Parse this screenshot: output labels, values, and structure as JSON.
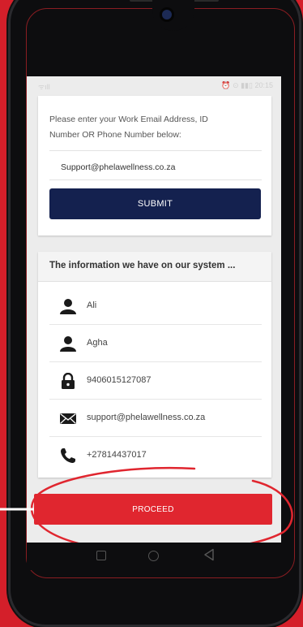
{
  "status_bar": {
    "signal": "ᯤıll",
    "right_icons": "⏰ ⊙ ▮▮▯ 20:15"
  },
  "email_card": {
    "prompt": "Please enter your Work Email Address, ID Number OR Phone Number below:",
    "input_value": "Support@phelawellness.co.za",
    "submit_label": "SUBMIT"
  },
  "info_card": {
    "title": "The information we have on our system ...",
    "rows": [
      {
        "icon": "person-icon",
        "value": "Ali"
      },
      {
        "icon": "person-icon",
        "value": "Agha"
      },
      {
        "icon": "lock-icon",
        "value": "9406015127087"
      },
      {
        "icon": "envelope-icon",
        "value": "support@phelawellness.co.za"
      },
      {
        "icon": "phone-icon",
        "value": "+27814437017"
      }
    ]
  },
  "proceed_label": "PROCEED",
  "colors": {
    "background": "#d41f2a",
    "submit": "#14214f",
    "proceed": "#e0262f",
    "annotation": "#e0262f"
  }
}
